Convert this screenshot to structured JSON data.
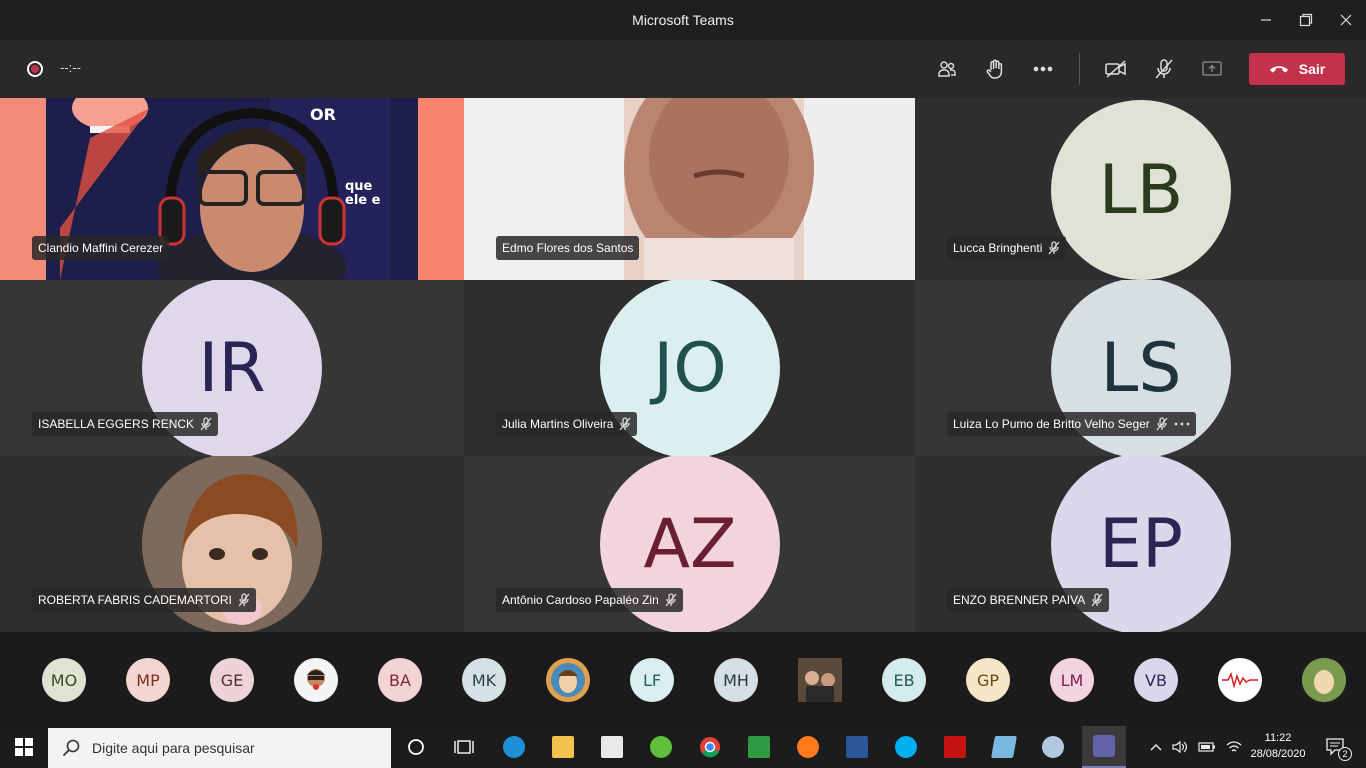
{
  "window": {
    "title": "Microsoft Teams"
  },
  "meeting": {
    "timer": "--:--",
    "leave_label": "Sair"
  },
  "tiles": [
    {
      "name": "Clandio Maffini Cerezer",
      "type": "video"
    },
    {
      "name": "Edmo Flores dos Santos",
      "type": "video"
    },
    {
      "name": "Lucca Bringhenti",
      "initials": "LB",
      "bg": "#dfe3d6",
      "fg": "#2c3a20",
      "muted": true
    },
    {
      "name": "ISABELLA EGGERS RENCK",
      "initials": "IR",
      "bg": "#ded8ea",
      "fg": "#2a2452",
      "muted": true
    },
    {
      "name": "Julia Martins Oliveira",
      "initials": "JO",
      "bg": "#dbeef0",
      "fg": "#21514f",
      "muted": true
    },
    {
      "name": "Luiza Lo Pumo de Britto Velho Seger",
      "initials": "LS",
      "bg": "#d7dfe3",
      "fg": "#1e333b",
      "muted": true
    },
    {
      "name": "ROBERTA FABRIS CADEMARTORI",
      "type": "photo",
      "muted": true
    },
    {
      "name": "Antônio Cardoso Papaléo Zin",
      "initials": "AZ",
      "bg": "#f4d4dc",
      "fg": "#6a1f35",
      "muted": true
    },
    {
      "name": "ENZO BRENNER PAIVA",
      "initials": "EP",
      "bg": "#dcd8ec",
      "fg": "#2b2554",
      "muted": true
    }
  ],
  "strip": [
    {
      "label": "MO",
      "bg": "#dfe4d3",
      "fg": "#3b4a28"
    },
    {
      "label": "MP",
      "bg": "#f3d6d0",
      "fg": "#7a2b22"
    },
    {
      "label": "GE",
      "bg": "#ecd4d6",
      "fg": "#5c2a32"
    },
    {
      "label": "",
      "bg": "#f5f5f5",
      "fg": "#333",
      "photo": true
    },
    {
      "label": "BA",
      "bg": "#f3d3d6",
      "fg": "#7a2a34"
    },
    {
      "label": "MK",
      "bg": "#d6e1e6",
      "fg": "#27424e"
    },
    {
      "label": "",
      "bg": "#e0a050",
      "fg": "#333",
      "photo": true
    },
    {
      "label": "LF",
      "bg": "#d9eef0",
      "fg": "#25605d"
    },
    {
      "label": "MH",
      "bg": "#d6dfe3",
      "fg": "#233a44"
    },
    {
      "label": "",
      "bg": "#6a5a4a",
      "fg": "#fff",
      "photo": true
    },
    {
      "label": "EB",
      "bg": "#d5ecee",
      "fg": "#245a59"
    },
    {
      "label": "GP",
      "bg": "#f6e5c8",
      "fg": "#6b4a12"
    },
    {
      "label": "LM",
      "bg": "#f4d4e0",
      "fg": "#7a2348"
    },
    {
      "label": "VB",
      "bg": "#dad6ec",
      "fg": "#2d275a"
    },
    {
      "label": "",
      "bg": "#ffffff",
      "fg": "#c00",
      "photo": true
    },
    {
      "label": "",
      "bg": "#8aa060",
      "fg": "#fff",
      "photo": true
    }
  ],
  "taskbar": {
    "search_placeholder": "Digite aqui para pesquisar",
    "time": "11:22",
    "date": "28/08/2020",
    "notifications": "2"
  },
  "colors": {
    "accent": "#c4314b",
    "teams": "#6264a7"
  }
}
